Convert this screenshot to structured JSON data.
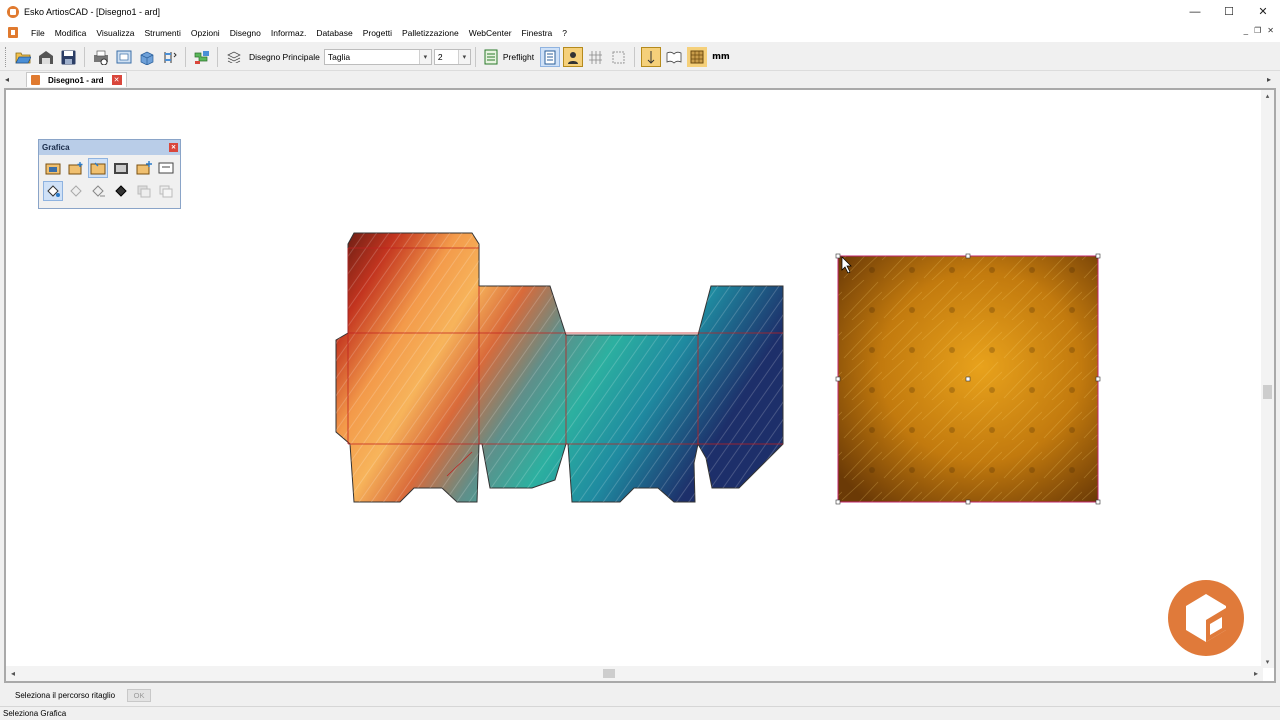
{
  "window": {
    "title": "Esko ArtiosCAD - [Disegno1 - ard]",
    "controls": {
      "minimize": "—",
      "maximize": "☐",
      "close": "✕"
    }
  },
  "menu": {
    "items": [
      "File",
      "Modifica",
      "Visualizza",
      "Strumenti",
      "Opzioni",
      "Disegno",
      "Informaz.",
      "Database",
      "Progetti",
      "Palletizzazione",
      "WebCenter",
      "Finestra",
      "?"
    ]
  },
  "toolbar": {
    "layer_label": "Disegno Principale",
    "size_select": "Taglia",
    "number_select": "2",
    "preflight_label": "Preflight",
    "units_label": "mm",
    "icons": [
      "open-icon",
      "open-db-icon",
      "save-icon",
      "print-icon",
      "zoom-window-icon",
      "3d-view-icon",
      "layers-icon",
      "converter-icon",
      "layer-stack-icon",
      "preflight-icon",
      "checklist-icon",
      "select-user-icon",
      "grid-icon",
      "fit-icon",
      "direction-icon",
      "book-icon",
      "board-icon"
    ]
  },
  "tabs": {
    "doc_title": "Disegno1 - ard"
  },
  "palette": {
    "title": "Grafica",
    "row1": [
      "import-graphic-icon",
      "add-graphic-icon",
      "select-graphic-icon",
      "graphic-frame-icon",
      "new-graphic-icon",
      "graphic-properties-icon"
    ],
    "row2": [
      "fill-icon",
      "paint-icon",
      "paint-alt-icon",
      "paint-dark-icon",
      "duplicate-icon",
      "copy-icon"
    ]
  },
  "command_bar": {
    "label": "Seleziona il percorso ritaglio",
    "ok_label": "OK"
  },
  "status": {
    "text": "Seleziona Grafica"
  },
  "colors": {
    "accent": "#e07a2f",
    "selection": "#c0246e",
    "cutline": "#c02020"
  }
}
